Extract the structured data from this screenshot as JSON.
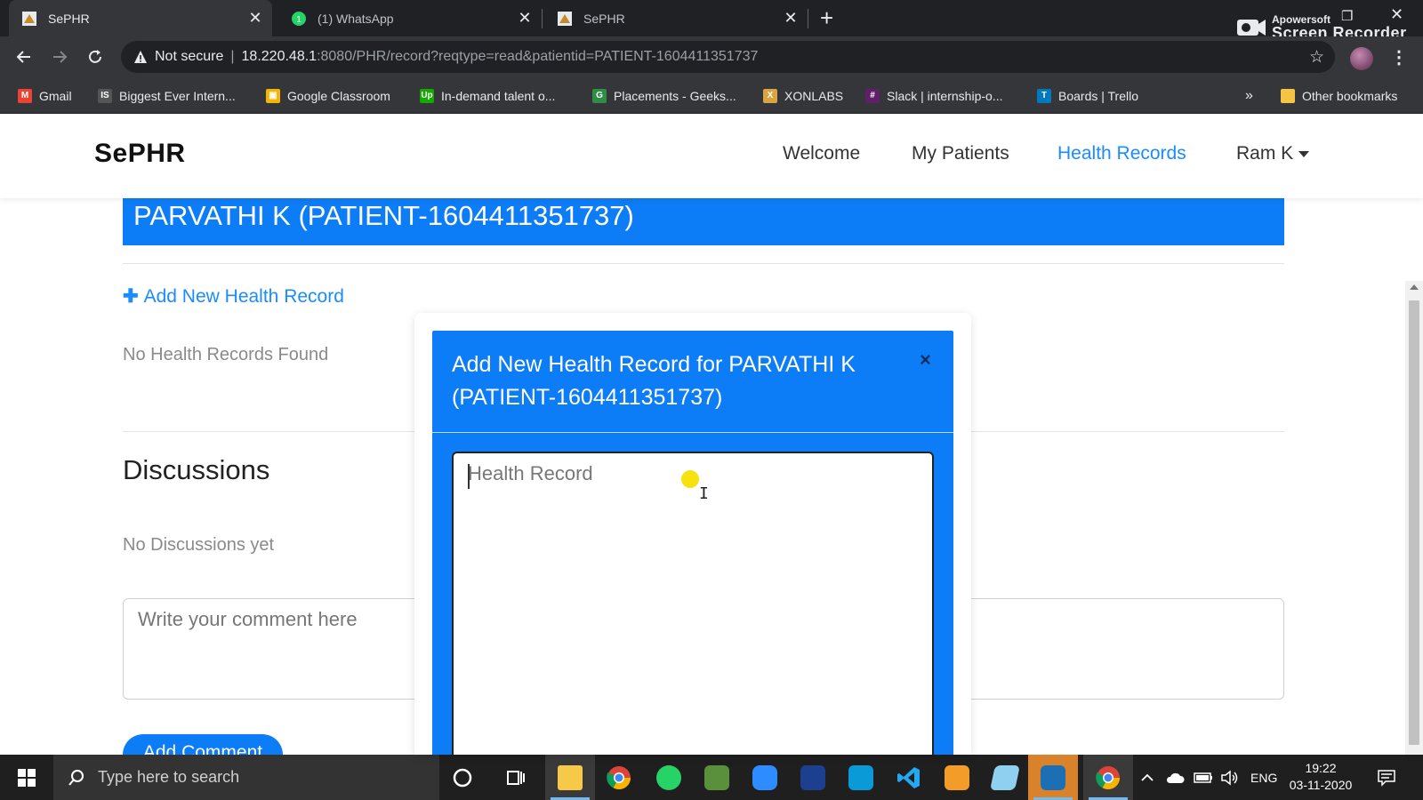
{
  "browser": {
    "tabs": [
      {
        "title": "SePHR",
        "active": true
      },
      {
        "title": "(1) WhatsApp",
        "active": false
      },
      {
        "title": "SePHR",
        "active": false
      }
    ],
    "recorder": {
      "line1": "Apowersoft",
      "line2": "Screen Recorder"
    },
    "address": {
      "security": "Not secure",
      "host": "18.220.48.1",
      "path": ":8080/PHR/record?reqtype=read&patientid=PATIENT-1604411351737"
    },
    "bookmarks": [
      {
        "label": "Gmail",
        "icon": "gmail-icon",
        "color": "#ea4335"
      },
      {
        "label": "Biggest Ever Intern...",
        "icon": "internshala-icon",
        "color": "#555555"
      },
      {
        "label": "Google Classroom",
        "icon": "classroom-icon",
        "color": "#f4b400"
      },
      {
        "label": "In-demand talent o...",
        "icon": "upwork-icon",
        "color": "#14a800"
      },
      {
        "label": "Placements - Geeks...",
        "icon": "geeksforgeeks-icon",
        "color": "#2f8d46"
      },
      {
        "label": "XONLABS",
        "icon": "xonlabs-icon",
        "color": "#d9a441"
      },
      {
        "label": "Slack | internship-o...",
        "icon": "slack-icon",
        "color": "#611f69"
      },
      {
        "label": "Boards | Trello",
        "icon": "trello-icon",
        "color": "#0079bf"
      }
    ],
    "overflow": "»",
    "other_bookmarks": "Other bookmarks"
  },
  "navbar": {
    "logo": "SePHR",
    "links": [
      "Welcome",
      "My Patients",
      "Health Records"
    ],
    "active_link": "Health Records",
    "user": "Ram K"
  },
  "page": {
    "patient_header": "PARVATHI K (PATIENT-1604411351737)",
    "add_record_link": "Add New Health Record",
    "no_records": "No Health Records Found",
    "discussions_title": "Discussions",
    "no_discussions": "No Discussions yet",
    "comment_placeholder": "Write your comment here",
    "add_comment_button": "Add Comment"
  },
  "modal": {
    "title": "Add New Health Record for PARVATHI K (PATIENT-1604411351737)",
    "close": "×",
    "record_placeholder": "Health Record"
  },
  "taskbar": {
    "search_placeholder": "Type here to search",
    "language": "ENG",
    "time": "19:22",
    "date": "03-11-2020"
  },
  "colors": {
    "primary": "#0d7cf7",
    "link": "#1a8cff"
  }
}
